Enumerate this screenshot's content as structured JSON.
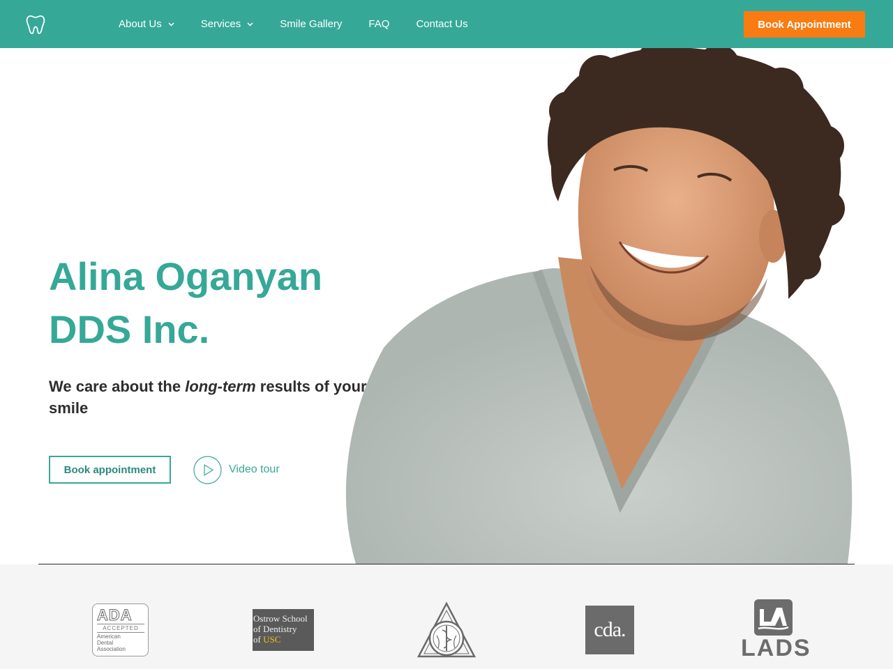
{
  "header": {
    "logo_icon": "tooth-icon",
    "nav": [
      {
        "label": "About Us",
        "has_dropdown": true
      },
      {
        "label": "Services",
        "has_dropdown": true
      },
      {
        "label": "Smile Gallery",
        "has_dropdown": false
      },
      {
        "label": "FAQ",
        "has_dropdown": false
      },
      {
        "label": "Contact Us",
        "has_dropdown": false
      }
    ],
    "cta_label": "Book Appointment"
  },
  "hero": {
    "title_line1": "Alina Oganyan",
    "title_line2": "DDS Inc.",
    "subtitle_before": "We care about the ",
    "subtitle_emphasis": "long-term",
    "subtitle_after": " results of your smile",
    "book_label": "Book appointment",
    "video_label": "Video tour",
    "video_icon": "play-icon"
  },
  "affiliations": {
    "ada": {
      "top": "ADA",
      "accepted": "ACCEPTED",
      "lines": [
        "American",
        "Dental",
        "Association"
      ]
    },
    "ostrow": {
      "line1": "Ostrow School",
      "line2": "of Dentistry",
      "line3_prefix": "of ",
      "line3_usc": "USC"
    },
    "seal_icon": "dental-seal-icon",
    "cda": "cda.",
    "lads": "LADS"
  },
  "colors": {
    "brand_teal": "#36a898",
    "cta_orange": "#f97c13",
    "strip_bg": "#f5f5f5"
  }
}
